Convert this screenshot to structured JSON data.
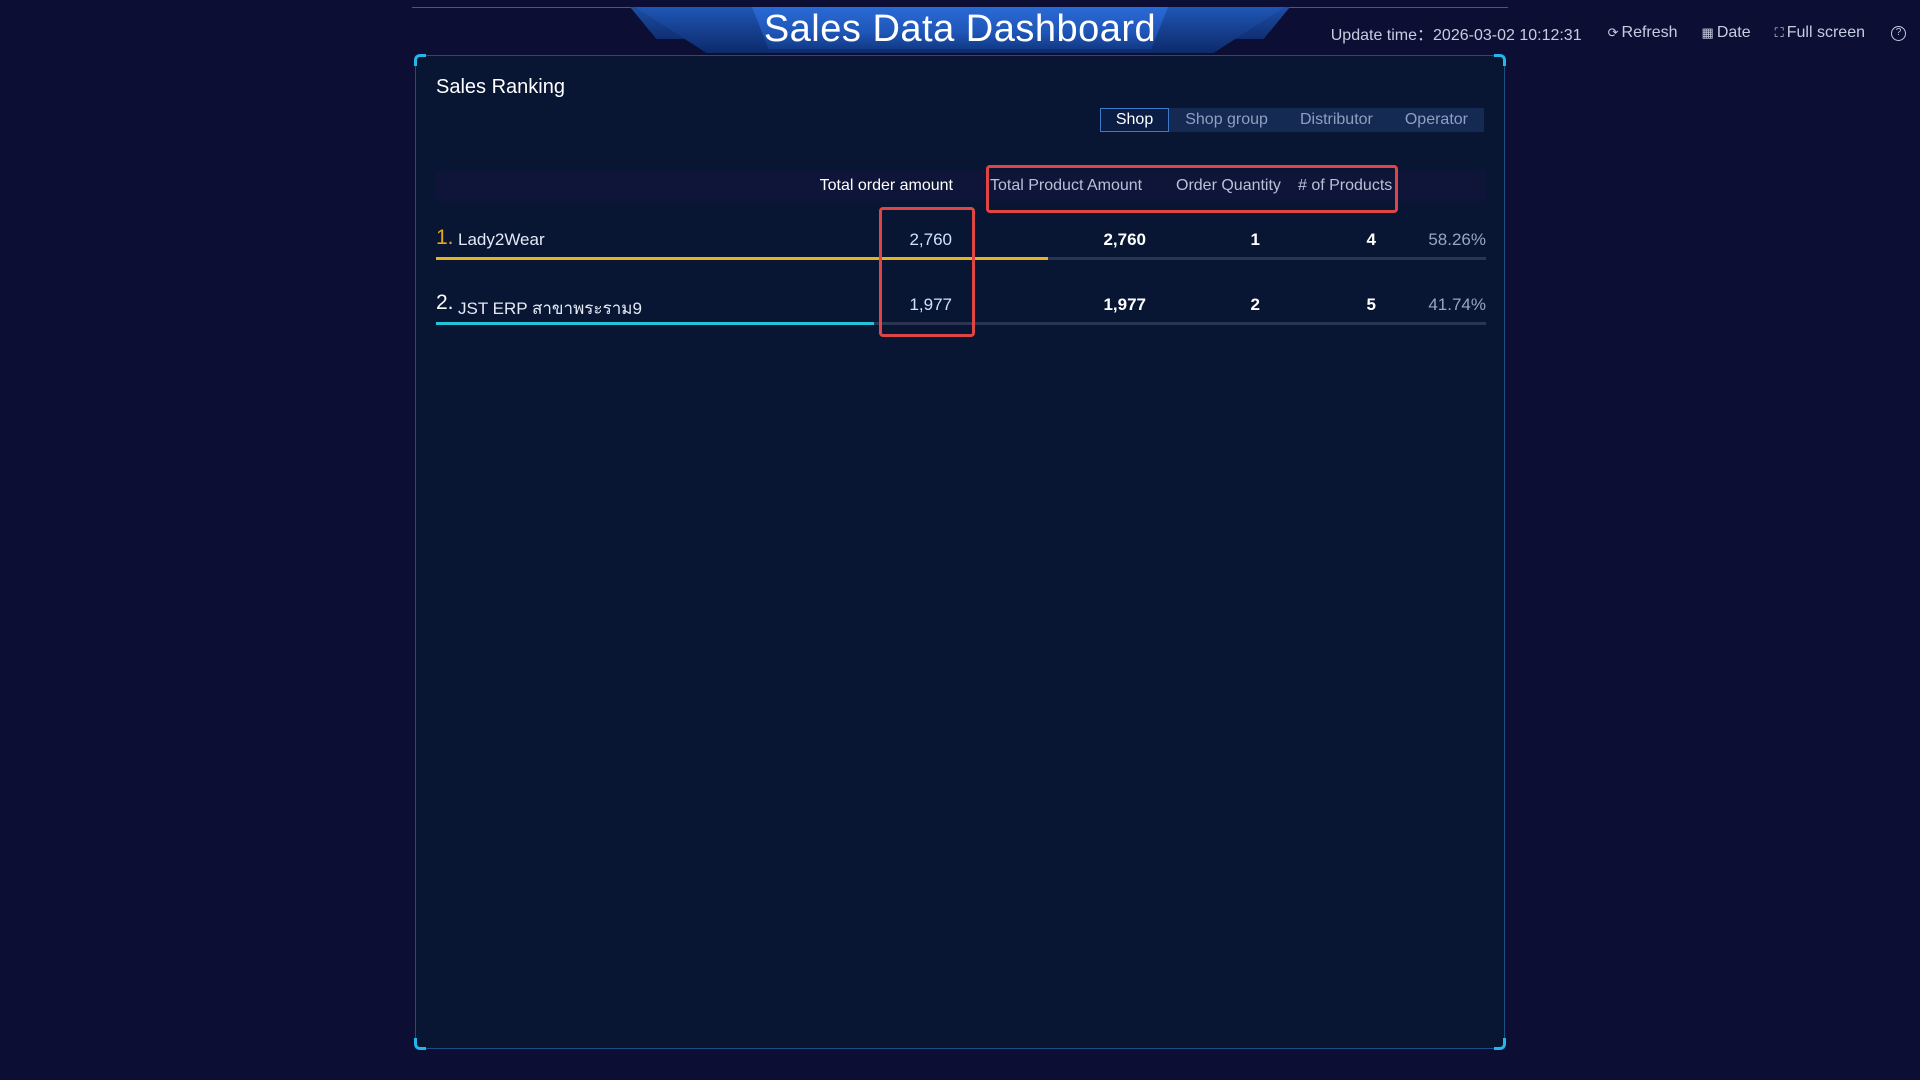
{
  "header": {
    "title": "Sales Data Dashboard",
    "update_time_label": "Update time：",
    "update_time_value": "2026-03-02 10:12:31",
    "refresh_label": "Refresh",
    "date_label": "Date",
    "fullscreen_label": "Full screen",
    "help_symbol": "?"
  },
  "panel": {
    "title": "Sales Ranking",
    "tabs": [
      {
        "label": "Shop",
        "active": true
      },
      {
        "label": "Shop group",
        "active": false
      },
      {
        "label": "Distributor",
        "active": false
      },
      {
        "label": "Operator",
        "active": false
      }
    ],
    "columns": {
      "total_order_amount": "Total order amount",
      "total_product_amount": "Total Product Amount",
      "order_quantity": "Order Quantity",
      "num_products": "# of Products"
    },
    "rows": [
      {
        "rank": "1.",
        "name": "Lady2Wear",
        "total_order_amount": "2,760",
        "total_product_amount": "2,760",
        "order_quantity": "1",
        "num_products": "4",
        "share": "58.26%",
        "share_value": 0.5826,
        "rank_color": "#e6a81a",
        "bar_color": "#e6b31e"
      },
      {
        "rank": "2.",
        "name": "JST ERP สาขาพระราม9",
        "total_order_amount": "1,977",
        "total_product_amount": "1,977",
        "order_quantity": "2",
        "num_products": "5",
        "share": "41.74%",
        "share_value": 0.4174,
        "rank_color": "#ffffff",
        "bar_color": "#22c4d8"
      }
    ]
  },
  "colors": {
    "background": "#0c0f33",
    "panel": "#081633",
    "accent": "#23b6e8",
    "highlight": "#e04545"
  }
}
